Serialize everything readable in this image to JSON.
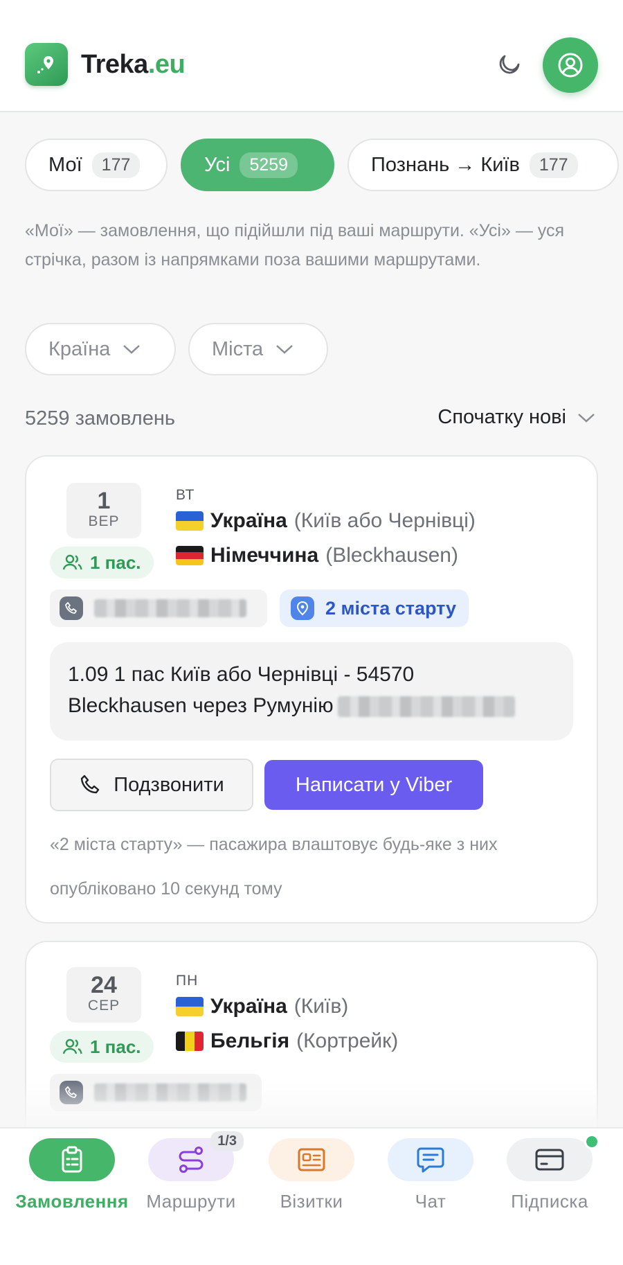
{
  "header": {
    "brand_main": "Treka",
    "brand_tld": ".eu"
  },
  "tabs": [
    {
      "label": "Мої",
      "count": "177"
    },
    {
      "label": "Усі",
      "count": "5259"
    },
    {
      "label": "Познань → Київ",
      "count": "177"
    }
  ],
  "hint_text": "«Мої» — замовлення, що підійшли під ваші маршрути. «Усі» — уся стрічка, разом із напрямками поза вашими маршрутами.",
  "filters": {
    "country": "Країна",
    "cities": "Міста"
  },
  "orders_count": "5259 замовлень",
  "sort_label": "Спочатку нові",
  "orders": [
    {
      "day": "1",
      "month": "ВЕР",
      "weekday": "ВТ",
      "pax": "1 пас.",
      "from_country": "Україна",
      "from_city": "(Київ або Чернівці)",
      "to_country": "Німеччина",
      "to_city": "(Bleckhausen)",
      "start_chip": "2 міста старту",
      "message_line1": "1.09 1 пас Київ або Чернівці  - 54570",
      "message_line2": "Bleckhausen через Румунію",
      "call_label": "Подзвонити",
      "viber_label": "Написати у Viber",
      "note": "«2 міста старту» — пасажира влаштовує будь-яке з них",
      "published": "опубліковано 10 секунд тому"
    },
    {
      "day": "24",
      "month": "СЕР",
      "weekday": "ПН",
      "pax": "1 пас.",
      "from_country": "Україна",
      "from_city": "(Київ)",
      "to_country": "Бельгія",
      "to_city": "(Кортрейк)"
    }
  ],
  "nav": [
    {
      "label": "Замовлення",
      "icon": "clipboard-icon"
    },
    {
      "label": "Маршрути",
      "icon": "route-icon",
      "badge": "1/3"
    },
    {
      "label": "Візитки",
      "icon": "id-card-icon"
    },
    {
      "label": "Чат",
      "icon": "chat-icon"
    },
    {
      "label": "Підписка",
      "icon": "credit-card-icon"
    }
  ],
  "colors": {
    "accent_green": "#4db572",
    "viber_purple": "#6b5cf0",
    "chip_blue": "#2a56c6"
  }
}
